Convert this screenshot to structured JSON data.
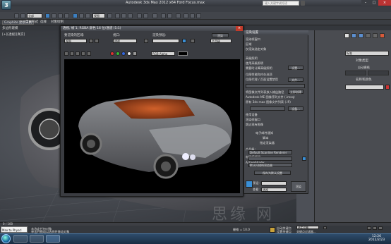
{
  "app": {
    "title": "Autodesk 3ds Max  2012 x64    Ford Focus.max",
    "search_placeholder": "键入关键字或短语"
  },
  "window_controls": {
    "minimize": "–",
    "maximize": "□",
    "close": "×"
  },
  "ribbon": {
    "tabs": [
      "Graphite 建模工具",
      "自由形式",
      "选择",
      "对象绘制"
    ],
    "mode": "多边形建模"
  },
  "viewport": {
    "label": "[+][透视][真实]",
    "toolbar_dropdown": "全部",
    "view_dropdown": "视图"
  },
  "render_frame": {
    "title": "透视, 帧 1, RGBA 颜色 16 位/通道 (1:1)",
    "area_label": "要渲染的区域:",
    "area_value": "视图",
    "viewport_label": "视口:",
    "viewport_value": "透视",
    "preset_label": "渲染预设:",
    "preset_value": "",
    "render_button": "渲染",
    "production_value": "产品级",
    "channel_value": "RGB Alpha"
  },
  "render_setup": {
    "title": "渲染设置",
    "lines": [
      "渲染帧窗口",
      "区域",
      "仅渲染选定对象",
      "高级照明",
      "使用高级照明",
      "需要时计算高级照明",
      "位图性能和内存选项",
      "位图代理 / 页面设置禁用",
      "渲染输出",
      "保存文件",
      "将图像文件列表放入输出路径",
      "Autodesk ME 图像序列文件 (.imsq)",
      "原有 3ds max 图像文件列表 (.ifl)",
      "使用设备",
      "渲染帧窗口",
      "跳过现有图像",
      "电子邮件通知",
      "脚本",
      "指定渲染器",
      "产品级:",
      "材质编辑器:",
      "ActiveShade:",
      "默认扫描线渲染器",
      "保存为默认设置"
    ],
    "buttons": {
      "setup": "设置...",
      "files": "文件...",
      "create": "立即创建",
      "devices": "设备...",
      "file_btn": "文件..."
    },
    "renderer": "Default Scanline Renderer",
    "preset_bottom_label": "预设:",
    "preset_bottom_value": "",
    "view_bottom_label": "查看:",
    "view_bottom_value": "透视",
    "render_bottom_button": "渲染",
    "production_mode": "产品"
  },
  "command_panel": {
    "dropdown": "标准",
    "object_type": "对象类型",
    "auto_grid": "自动栅格",
    "name_color": "名称和颜色"
  },
  "status": {
    "maxscript": "Max to Physcl",
    "selected": "未选定任何对象",
    "hint": "单击并拖动以选择并移动对象",
    "grid": "栅格 = 10.0",
    "auto_key": "自动关键点",
    "selected_dropdown": "选定对象",
    "set_key": "设置关键点",
    "key_filter": "关键点过滤器...",
    "frame": "0 / 100"
  },
  "taskbar": {
    "time": "12:26",
    "date": "2012/2/23"
  },
  "colors": {
    "accent": "#3c7fc0",
    "title_bar": "#41444a",
    "panel": "#45474c",
    "render_bg": "#000000",
    "car_interior": "#b24a1c"
  },
  "icons": [
    "app-logo-icon",
    "search-icon",
    "close-icon",
    "start-orb-icon",
    "ie-icon",
    "folder-icon",
    "3dsmax-icon"
  ]
}
